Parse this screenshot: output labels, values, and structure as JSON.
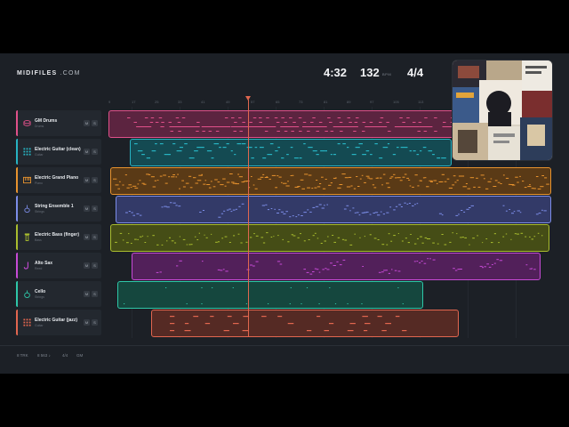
{
  "brand": {
    "bold": "MIDIFILES",
    "light": ".COM"
  },
  "transport": {
    "time": "4:32",
    "bpm": "132",
    "bpm_unit": "BPM",
    "signature": "4/4"
  },
  "ruler": [
    "9",
    "17",
    "25",
    "33",
    "41",
    "49",
    "57",
    "65",
    "73",
    "81",
    "89",
    "97",
    "105",
    "113"
  ],
  "tracks": [
    {
      "name": "GM Drums",
      "sub": "Drums",
      "color": "#e0508a",
      "icon": "drum-icon",
      "mute": "M",
      "solo": "S"
    },
    {
      "name": "Electric Guitar (clean)",
      "sub": "Guitar",
      "color": "#27b3c2",
      "icon": "guitar-grid-icon",
      "mute": "M",
      "solo": "S"
    },
    {
      "name": "Electric Grand Piano",
      "sub": "Piano",
      "color": "#e8932e",
      "icon": "piano-icon",
      "mute": "M",
      "solo": "S"
    },
    {
      "name": "String Ensemble 1",
      "sub": "Strings",
      "color": "#7c8de8",
      "icon": "strings-icon",
      "mute": "M",
      "solo": "S"
    },
    {
      "name": "Electric Bass (finger)",
      "sub": "Bass",
      "color": "#a9bd2e",
      "icon": "bass-icon",
      "mute": "M",
      "solo": "S"
    },
    {
      "name": "Alto Sax",
      "sub": "Reed",
      "color": "#c64ad6",
      "icon": "sax-icon",
      "mute": "M",
      "solo": "S"
    },
    {
      "name": "Cello",
      "sub": "Strings",
      "color": "#2ec7a8",
      "icon": "cello-icon",
      "mute": "M",
      "solo": "S"
    },
    {
      "name": "Electric Guitar (jazz)",
      "sub": "Guitar",
      "color": "#e2664f",
      "icon": "guitar-grid-icon",
      "mute": "M",
      "solo": "S"
    }
  ],
  "footer": {
    "tracks": "8 TRK",
    "notes": "8 563 ♪",
    "sig": "4/4",
    "std": "GM"
  }
}
